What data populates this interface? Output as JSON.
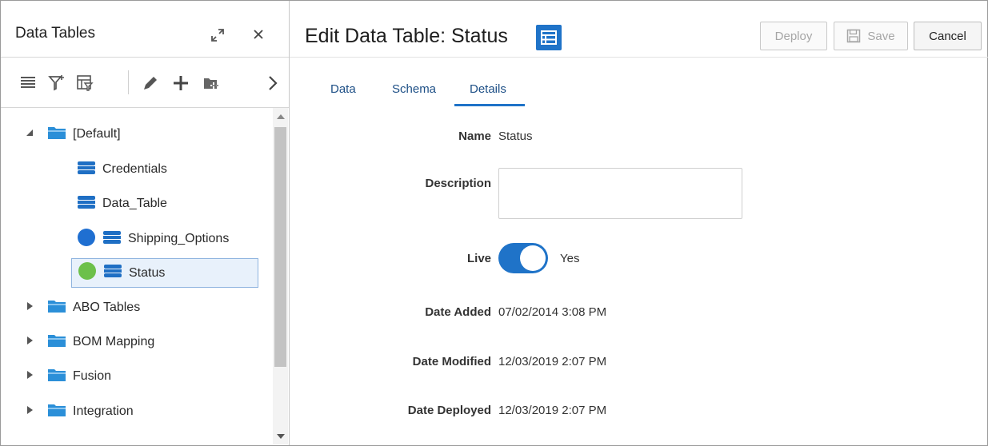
{
  "left_panel": {
    "title": "Data Tables",
    "tree": [
      {
        "label": "[Default]",
        "expanded": true
      },
      {
        "label": "Credentials"
      },
      {
        "label": "Data_Table"
      },
      {
        "label": "Shipping_Options",
        "status_color": "#1f6fd1"
      },
      {
        "label": "Status",
        "status_color": "#6cc04a",
        "selected": true
      },
      {
        "label": "ABO Tables",
        "expanded": false
      },
      {
        "label": "BOM Mapping",
        "expanded": false
      },
      {
        "label": "Fusion",
        "expanded": false
      },
      {
        "label": "Integration",
        "expanded": false
      }
    ],
    "toolbar_icons": [
      "list-icon",
      "filter-icon",
      "filter-table-icon",
      "edit-icon",
      "add-icon",
      "add-folder-icon",
      "chevron-right-icon"
    ]
  },
  "header": {
    "title": "Edit Data Table: Status",
    "deploy_label": "Deploy",
    "save_label": "Save",
    "cancel_label": "Cancel"
  },
  "tabs": [
    {
      "label": "Data"
    },
    {
      "label": "Schema"
    },
    {
      "label": "Details",
      "active": true
    }
  ],
  "details": {
    "name_label": "Name",
    "name_value": "Status",
    "description_label": "Description",
    "description_value": "",
    "live_label": "Live",
    "live_value": "Yes",
    "live_on": true,
    "date_added_label": "Date Added",
    "date_added_value": "07/02/2014 3:08 PM",
    "date_modified_label": "Date Modified",
    "date_modified_value": "12/03/2019 2:07 PM",
    "date_deployed_label": "Date Deployed",
    "date_deployed_value": "12/03/2019 2:07 PM"
  },
  "colors": {
    "accent": "#1f73c8",
    "folder": "#2b8fd8",
    "table_icon": "#1f6fc4"
  }
}
